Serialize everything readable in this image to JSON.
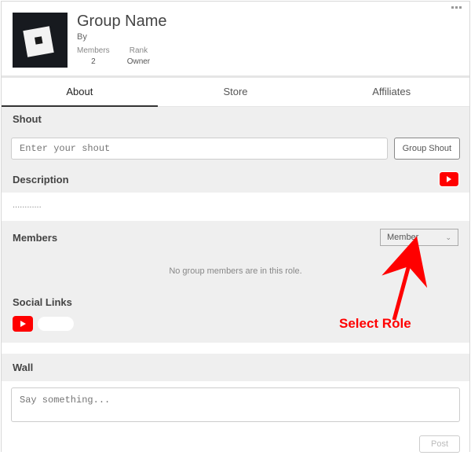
{
  "header": {
    "title": "Group Name",
    "by_label": "By",
    "stats": {
      "members_label": "Members",
      "members_value": "2",
      "rank_label": "Rank",
      "rank_value": "Owner"
    }
  },
  "tabs": {
    "about": "About",
    "store": "Store",
    "affiliates": "Affiliates"
  },
  "shout": {
    "title": "Shout",
    "placeholder": "Enter your shout",
    "button": "Group Shout"
  },
  "description": {
    "title": "Description",
    "content": "............"
  },
  "members": {
    "title": "Members",
    "selected_role": "Member",
    "empty_msg": "No group members are in this role."
  },
  "social": {
    "title": "Social Links"
  },
  "wall": {
    "title": "Wall",
    "placeholder": "Say something...",
    "post": "Post"
  },
  "annotation": {
    "label": "Select Role"
  }
}
